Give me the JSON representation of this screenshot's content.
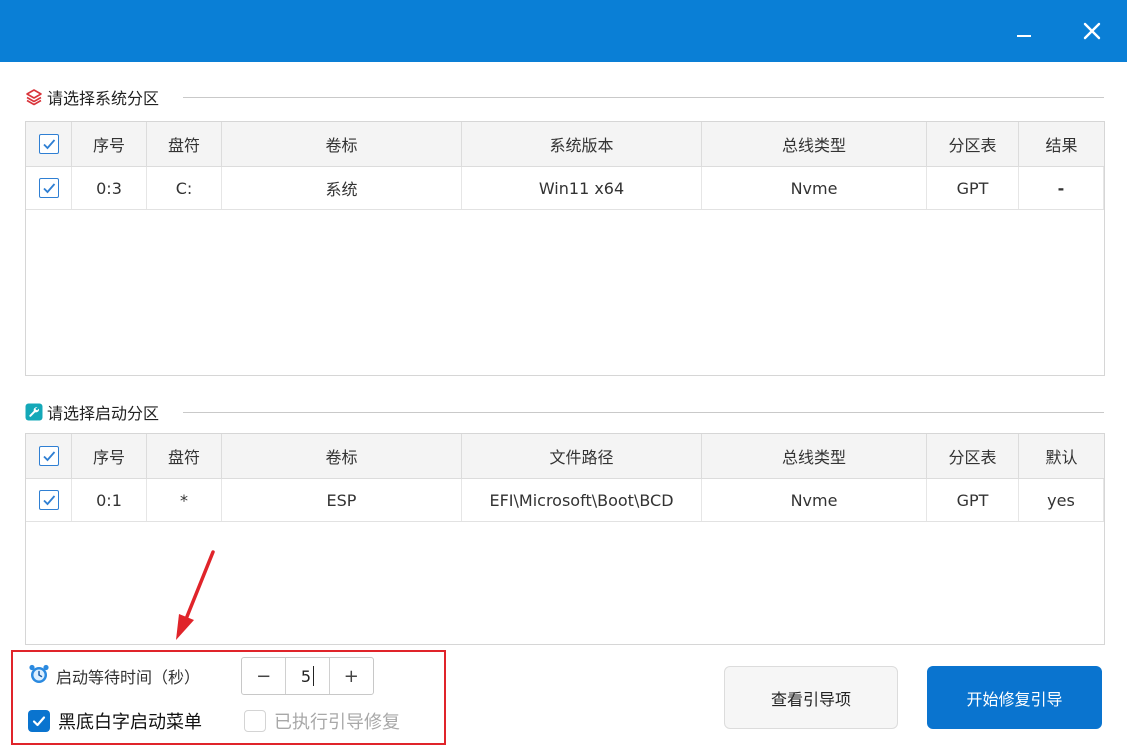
{
  "window": {
    "minimize_label": "—",
    "close_label": "✕"
  },
  "system_section": {
    "title": "请选择系统分区",
    "icon": "layers-icon",
    "columns": [
      "",
      "序号",
      "盘符",
      "卷标",
      "系统版本",
      "总线类型",
      "分区表",
      "结果"
    ],
    "rows": [
      {
        "checked": true,
        "index": "0:3",
        "drive": "C:",
        "label": "系统",
        "version": "Win11 x64",
        "bus": "Nvme",
        "table": "GPT",
        "result": "-"
      }
    ]
  },
  "boot_section": {
    "title": "请选择启动分区",
    "icon": "wrench-icon",
    "columns": [
      "",
      "序号",
      "盘符",
      "卷标",
      "文件路径",
      "总线类型",
      "分区表",
      "默认"
    ],
    "rows": [
      {
        "checked": true,
        "index": "0:1",
        "drive": "*",
        "label": "ESP",
        "path": "EFI\\Microsoft\\Boot\\BCD",
        "bus": "Nvme",
        "table": "GPT",
        "default": "yes"
      }
    ]
  },
  "options": {
    "delay_label": "启动等待时间（秒）",
    "delay_icon": "alarm-clock-icon",
    "delay_value": "5",
    "minus_label": "−",
    "plus_label": "+",
    "black_menu_label": "黑底白字启动菜单",
    "black_menu_checked": true,
    "executed_label": "已执行引导修复",
    "executed_checked": false
  },
  "buttons": {
    "view_label": "查看引导项",
    "start_label": "开始修复引导"
  },
  "colors": {
    "accent": "#0a7fd6",
    "highlight": "#e0242a"
  }
}
